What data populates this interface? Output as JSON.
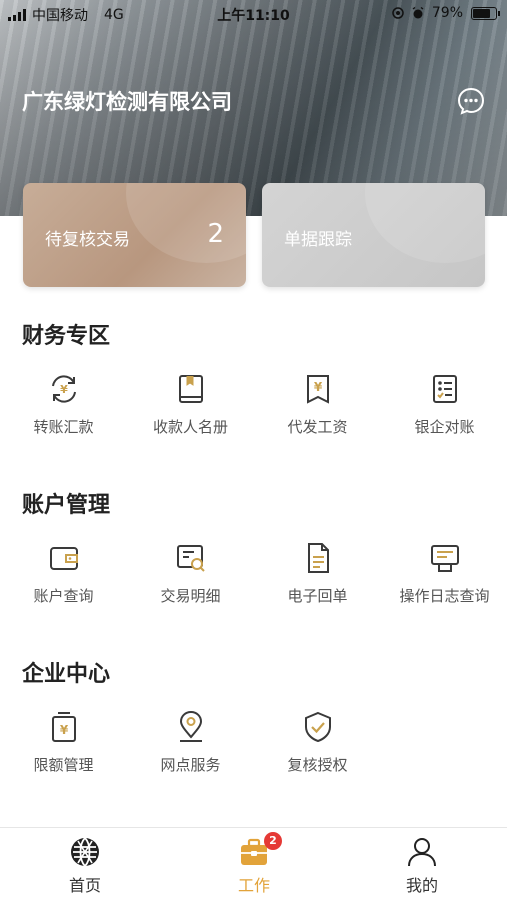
{
  "status_bar": {
    "carrier": "中国移动",
    "network": "4G",
    "time": "上午11:10",
    "battery": "79%"
  },
  "header": {
    "company_name": "广东绿灯检测有限公司",
    "chat_icon": "chat-bubble-icon"
  },
  "cards": [
    {
      "label": "待复核交易",
      "count": "2"
    },
    {
      "label": "单据跟踪"
    }
  ],
  "sections": {
    "finance": {
      "title": "财务专区",
      "items": [
        "转账汇款",
        "收款人名册",
        "代发工资",
        "银企对账"
      ]
    },
    "account": {
      "title": "账户管理",
      "items": [
        "账户查询",
        "交易明细",
        "电子回单",
        "操作日志查询"
      ]
    },
    "enterprise": {
      "title": "企业中心",
      "items": [
        "限额管理",
        "网点服务",
        "复核授权"
      ]
    }
  },
  "tabs": [
    {
      "label": "首页",
      "icon": "globe-icon"
    },
    {
      "label": "工作",
      "icon": "briefcase-icon",
      "badge": "2"
    },
    {
      "label": "我的",
      "icon": "user-icon"
    }
  ],
  "colors": {
    "accent": "#e2a33a",
    "icon_stroke": "#3a3a3a",
    "icon_accent": "#c9a14d",
    "badge": "#e53935"
  }
}
